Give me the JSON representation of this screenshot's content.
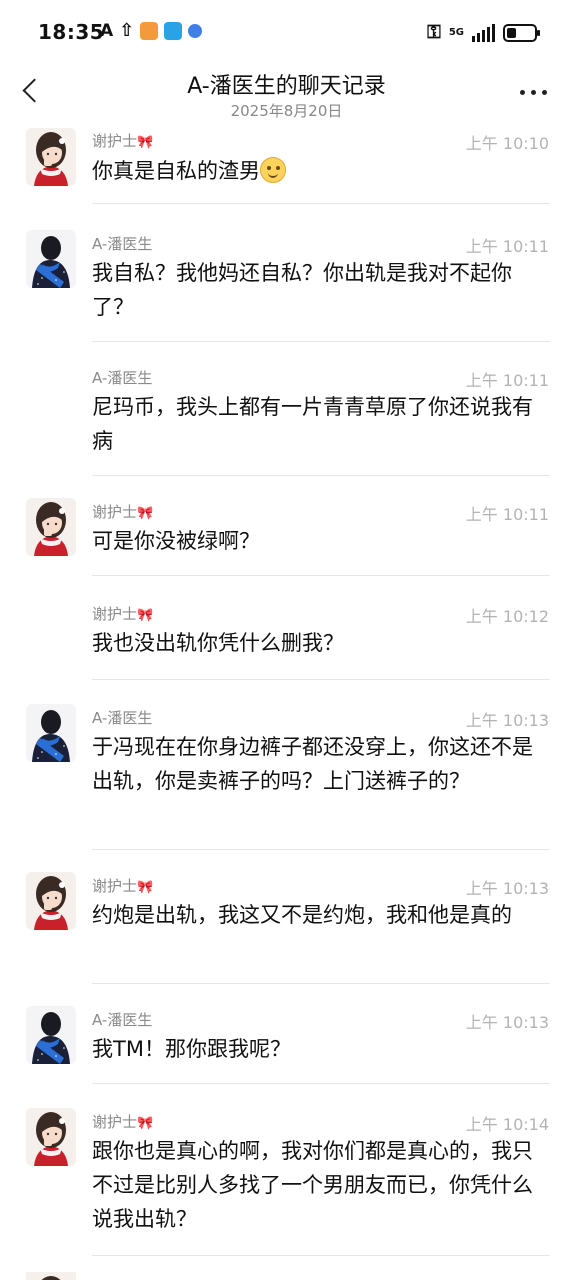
{
  "status_bar": {
    "time": "18:35",
    "network": "5G",
    "icons_left": [
      "a-icon",
      "upload-icon",
      "shield-app-icon",
      "book-app-icon",
      "ball-app-icon"
    ],
    "icons_right": [
      "key-icon",
      "signal-icon",
      "battery-icon"
    ]
  },
  "header": {
    "title": "A-潘医生的聊天记录",
    "date": "2025年8月20日"
  },
  "messages": [
    {
      "sender": "谢护士",
      "time": "上午 10:10",
      "text": "你真是自私的渣男"
    },
    {
      "sender": "A-潘医生",
      "time": "上午 10:11",
      "text": "我自私？我他妈还自私？你出轨是我对不起你了？"
    },
    {
      "sender": "A-潘医生",
      "time": "上午 10:11",
      "text": "尼玛币，我头上都有一片青青草原了你还说我有病"
    },
    {
      "sender": "谢护士",
      "time": "上午 10:11",
      "text": "可是你没被绿啊？"
    },
    {
      "sender": "谢护士",
      "time": "上午 10:12",
      "text": "我也没出轨你凭什么删我？"
    },
    {
      "sender": "A-潘医生",
      "time": "上午 10:13",
      "text": "于冯现在在你身边裤子都还没穿上，你这还不是出轨，你是卖裤子的吗？上门送裤子的？"
    },
    {
      "sender": "谢护士",
      "time": "上午 10:13",
      "text": "约炮是出轨，我这又不是约炮，我和他是真的"
    },
    {
      "sender": "A-潘医生",
      "time": "上午 10:13",
      "text": "我TM！那你跟我呢？"
    },
    {
      "sender": "谢护士",
      "time": "上午 10:14",
      "text": "跟你也是真心的啊，我对你们都是真心的，我只不过是比别人多找了一个男朋友而已，你凭什么说我出轨？"
    }
  ],
  "colors": {
    "background": "#ffffff",
    "meta_text": "#8a8a8a",
    "time_text": "#b3b3b3",
    "bow": "#e56b9c"
  }
}
